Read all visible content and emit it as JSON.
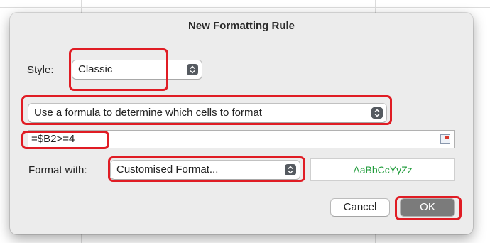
{
  "dialog": {
    "title": "New Formatting Rule",
    "style_label": "Style:",
    "style_value": "Classic",
    "rule_type": "Use a formula to determine which cells to format",
    "formula": "=$B2>=4",
    "format_with_label": "Format with:",
    "format_value": "Customised Format...",
    "preview_text": "AaBbCcYyZz",
    "cancel_label": "Cancel",
    "ok_label": "OK"
  },
  "colors": {
    "highlight": "#e01c24",
    "preview_text": "#1f9b3a",
    "default_button": "#7b7b7b"
  },
  "icons": [
    "popup-stepper-icon",
    "range-select-icon"
  ]
}
